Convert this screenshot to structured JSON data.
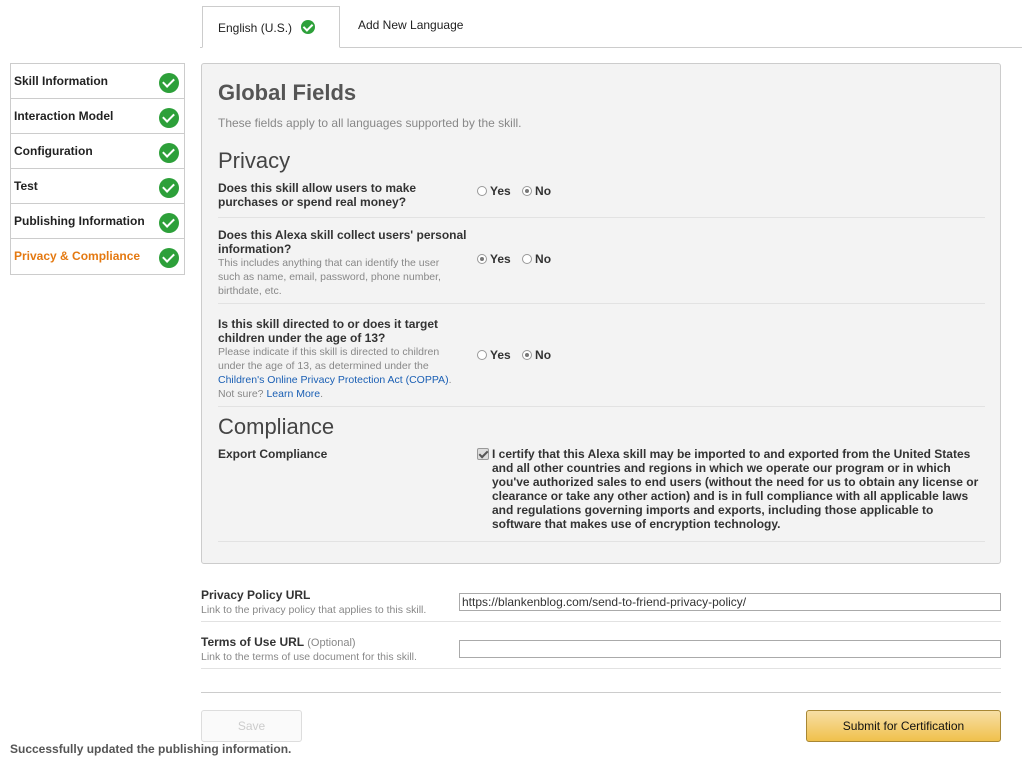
{
  "tabs": [
    {
      "label": "English (U.S.)",
      "active": true
    },
    {
      "label": "Add New Language",
      "active": false
    }
  ],
  "sidebar": {
    "items": [
      {
        "label": "Skill Information",
        "complete": true
      },
      {
        "label": "Interaction Model",
        "complete": true
      },
      {
        "label": "Configuration",
        "complete": true
      },
      {
        "label": "Test",
        "complete": true
      },
      {
        "label": "Publishing Information",
        "complete": true
      },
      {
        "label": "Privacy & Compliance",
        "complete": true,
        "active": true
      }
    ]
  },
  "global": {
    "title": "Global Fields",
    "subtitle": "These fields apply to all languages supported by the skill."
  },
  "privacy": {
    "heading": "Privacy",
    "q1": {
      "line1": "Does this skill allow users to make",
      "line2": "purchases or spend real money?",
      "yes": "Yes",
      "no": "No",
      "selected": "No"
    },
    "q2": {
      "line1": "Does this Alexa skill collect users' personal",
      "line2": "information?",
      "hint1": "This includes anything that can identify the user",
      "hint2": "such as name, email, password, phone number,",
      "hint3": "birthdate, etc.",
      "yes": "Yes",
      "no": "No",
      "selected": "Yes"
    },
    "q3": {
      "line1": "Is this skill directed to or does it target",
      "line2": "children under the age of 13?",
      "hint1": "Please indicate if this skill is directed to children",
      "hint2": "under the age of 13, as determined under the",
      "hint_link": "Children's Online Privacy Protection Act (COPPA)",
      "hint_link_suffix": ".",
      "hint_not_sure": "Not sure?",
      "hint_learn_more": "Learn More",
      "hint_end": ".",
      "yes": "Yes",
      "no": "No",
      "selected": "No"
    }
  },
  "compliance": {
    "heading": "Compliance",
    "label": "Export Compliance",
    "checked": true,
    "cert_lines": [
      "I certify that this Alexa skill may be imported to and exported from the United States",
      "and all other countries and regions in which we operate our program or in which",
      "you've authorized sales to end users (without the need for us to obtain any license or",
      "clearance or take any other action) and is in full compliance with all applicable laws",
      "and regulations governing imports and exports, including those applicable to",
      "software that makes use of encryption technology."
    ]
  },
  "privacy_url": {
    "label": "Privacy Policy URL",
    "hint": "Link to the privacy policy that applies to this skill.",
    "value": "https://blankenblog.com/send-to-friend-privacy-policy/"
  },
  "terms_url": {
    "label": "Terms of Use URL",
    "optional": "(Optional)",
    "hint": "Link to the terms of use document for this skill.",
    "value": ""
  },
  "buttons": {
    "save": "Save",
    "submit": "Submit for Certification"
  },
  "status_message": "Successfully updated the publishing information.",
  "colors": {
    "check_green": "#2da03a",
    "active_orange": "#e47911",
    "link_blue": "#1a5fb4",
    "submit_yellow": "#f0c14b"
  }
}
